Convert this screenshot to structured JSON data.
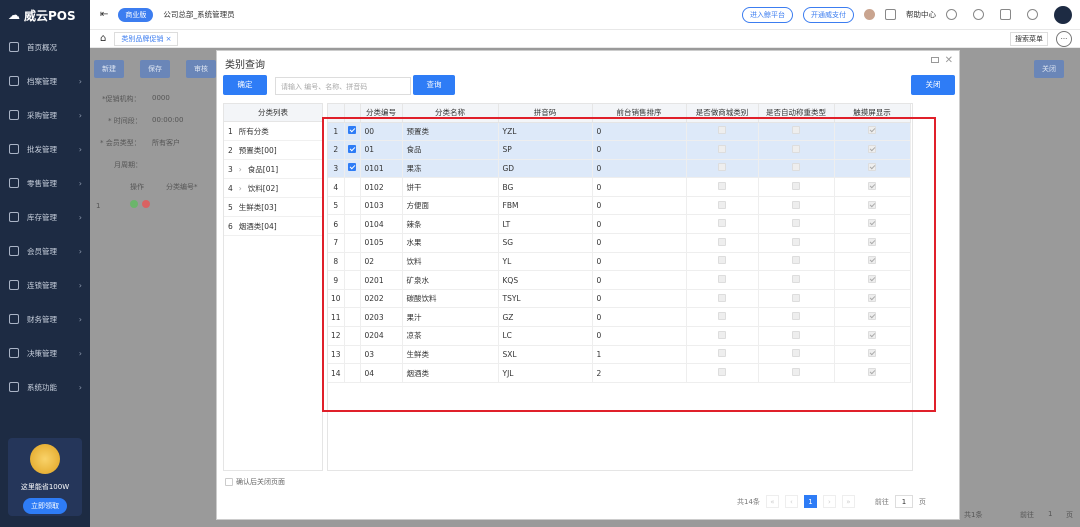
{
  "app": {
    "logo": "威云POS",
    "edition": "商业版",
    "user": "公司总部_系统管理员",
    "link1": "进入鲸平台",
    "link2": "开通威支付",
    "help": "帮助中心",
    "search_menu": "搜索菜单"
  },
  "sidebar": {
    "items": [
      {
        "label": "首页概况"
      },
      {
        "label": "档案管理"
      },
      {
        "label": "采购管理"
      },
      {
        "label": "批发管理"
      },
      {
        "label": "零售管理"
      },
      {
        "label": "库存管理"
      },
      {
        "label": "会员管理"
      },
      {
        "label": "连锁管理"
      },
      {
        "label": "财务管理"
      },
      {
        "label": "决策管理"
      },
      {
        "label": "系统功能"
      }
    ],
    "promo_text": "这里能省100W",
    "promo_button": "立即领取"
  },
  "tabs": [
    {
      "label": "类别品牌促销"
    }
  ],
  "background": {
    "new": "新建",
    "save": "保存",
    "audit": "审核",
    "close": "关闭",
    "org_label": "*促销机构：",
    "org_value": "0000",
    "time_label": "* 时间段：",
    "time_value": "00:00:00",
    "member_label": "* 会员类型：",
    "member_value": "所有客户",
    "month_label": "月周期：",
    "op_header": "操作",
    "code_header": "分类编号*",
    "row_no": "1",
    "page_total": "共1条",
    "page_goto": "前往",
    "page_num": "1",
    "page_unit": "页"
  },
  "dialog": {
    "title": "类别查询",
    "confirm": "确定",
    "search_placeholder": "请输入 编号、名称、拼音码",
    "query": "查询",
    "close": "关闭",
    "cat_header": "分类列表",
    "categories": [
      {
        "no": "1",
        "name": "所有分类"
      },
      {
        "no": "2",
        "name": "预置类[00]"
      },
      {
        "no": "3",
        "name": "食品[01]",
        "arrow": "›"
      },
      {
        "no": "4",
        "name": "饮料[02]",
        "arrow": "›"
      },
      {
        "no": "5",
        "name": "生鲜类[03]"
      },
      {
        "no": "6",
        "name": "烟酒类[04]"
      }
    ],
    "close_after": "确认后关闭页面",
    "columns": [
      "分类编号",
      "分类名称",
      "拼音码",
      "前台销售排序",
      "是否做商城类别",
      "是否自动称重类型",
      "触摸屏显示"
    ],
    "rows": [
      {
        "n": "1",
        "code": "00",
        "name": "预置类",
        "py": "YZL",
        "sort": "0",
        "sel": true
      },
      {
        "n": "2",
        "code": "01",
        "name": "食品",
        "py": "SP",
        "sort": "0",
        "sel": true
      },
      {
        "n": "3",
        "code": "0101",
        "name": "果冻",
        "py": "GD",
        "sort": "0",
        "sel": true
      },
      {
        "n": "4",
        "code": "0102",
        "name": "饼干",
        "py": "BG",
        "sort": "0",
        "sel": false
      },
      {
        "n": "5",
        "code": "0103",
        "name": "方便面",
        "py": "FBM",
        "sort": "0",
        "sel": false
      },
      {
        "n": "6",
        "code": "0104",
        "name": "辣条",
        "py": "LT",
        "sort": "0",
        "sel": false
      },
      {
        "n": "7",
        "code": "0105",
        "name": "水果",
        "py": "SG",
        "sort": "0",
        "sel": false
      },
      {
        "n": "8",
        "code": "02",
        "name": "饮料",
        "py": "YL",
        "sort": "0",
        "sel": false
      },
      {
        "n": "9",
        "code": "0201",
        "name": "矿泉水",
        "py": "KQS",
        "sort": "0",
        "sel": false
      },
      {
        "n": "10",
        "code": "0202",
        "name": "碳酸饮料",
        "py": "TSYL",
        "sort": "0",
        "sel": false
      },
      {
        "n": "11",
        "code": "0203",
        "name": "果汁",
        "py": "GZ",
        "sort": "0",
        "sel": false
      },
      {
        "n": "12",
        "code": "0204",
        "name": "凉茶",
        "py": "LC",
        "sort": "0",
        "sel": false
      },
      {
        "n": "13",
        "code": "03",
        "name": "生鲜类",
        "py": "SXL",
        "sort": "1",
        "sel": false
      },
      {
        "n": "14",
        "code": "04",
        "name": "烟酒类",
        "py": "YJL",
        "sort": "2",
        "sel": false
      }
    ],
    "total": "共14条",
    "current_page": "1",
    "goto": "前往",
    "goto_page": "1",
    "page_unit": "页"
  },
  "colors": {
    "sidebar": "#1d2b43",
    "accent": "#2e7cf6",
    "highlight": "#e0202a"
  }
}
